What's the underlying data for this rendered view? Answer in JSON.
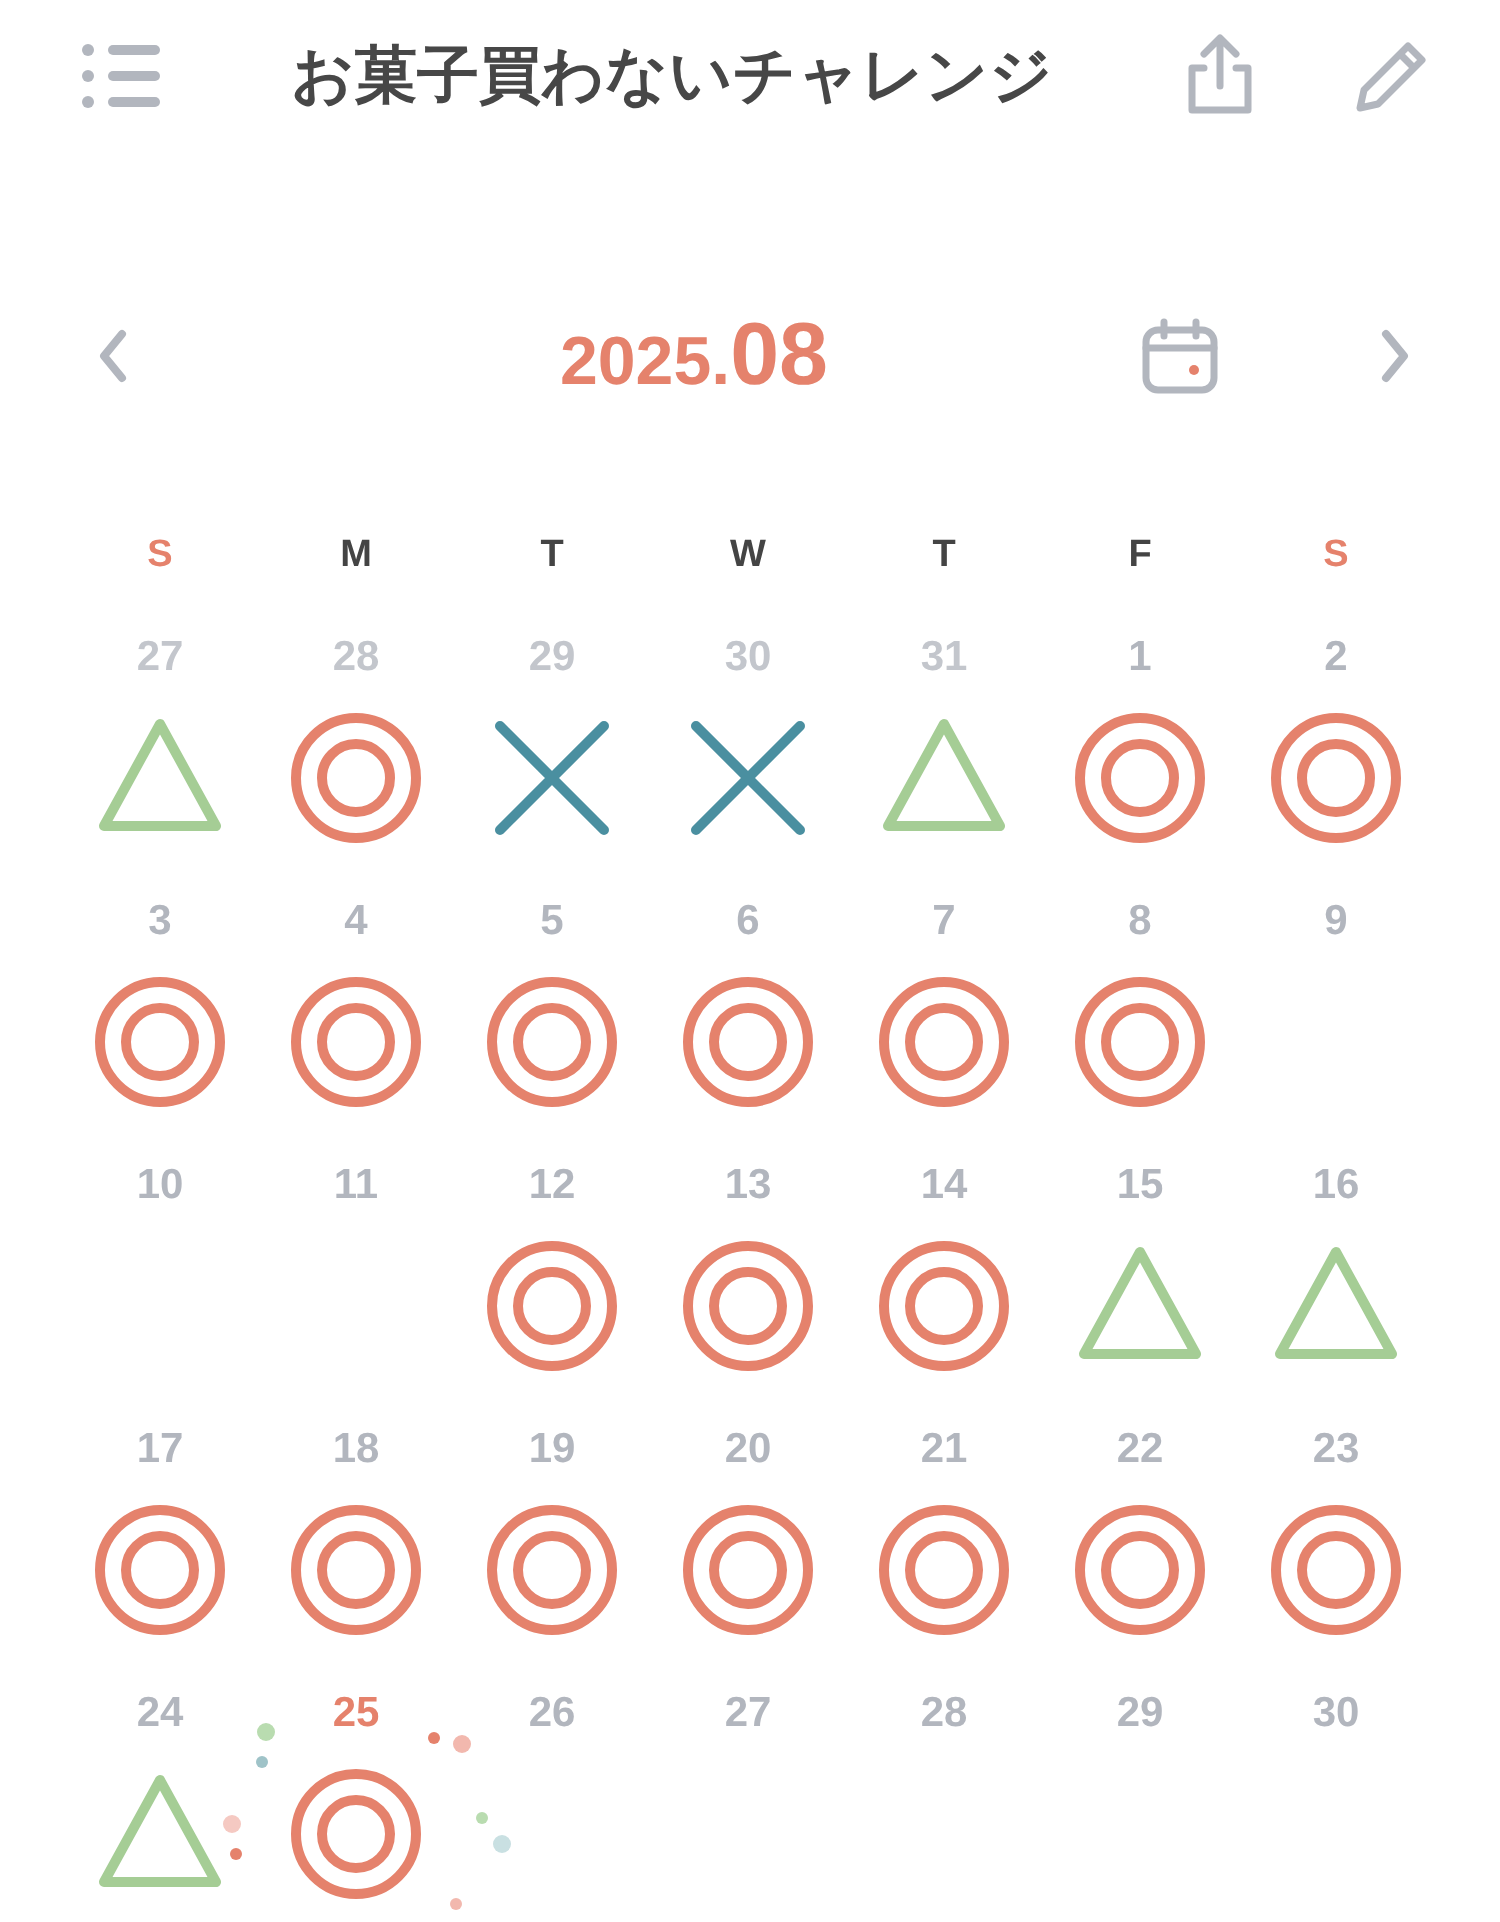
{
  "header": {
    "title": "お菓子買わないチャレンジ"
  },
  "month_nav": {
    "year": "2025.",
    "month": "08"
  },
  "weekdays": [
    {
      "label": "S",
      "weekend": true
    },
    {
      "label": "M",
      "weekend": false
    },
    {
      "label": "T",
      "weekend": false
    },
    {
      "label": "W",
      "weekend": false
    },
    {
      "label": "T",
      "weekend": false
    },
    {
      "label": "F",
      "weekend": false
    },
    {
      "label": "S",
      "weekend": true
    }
  ],
  "weeks": [
    [
      {
        "day": "27",
        "in_month": false,
        "today": false,
        "kind": "triangle"
      },
      {
        "day": "28",
        "in_month": false,
        "today": false,
        "kind": "double_circle"
      },
      {
        "day": "29",
        "in_month": false,
        "today": false,
        "kind": "cross"
      },
      {
        "day": "30",
        "in_month": false,
        "today": false,
        "kind": "cross"
      },
      {
        "day": "31",
        "in_month": false,
        "today": false,
        "kind": "triangle"
      },
      {
        "day": "1",
        "in_month": true,
        "today": false,
        "kind": "double_circle"
      },
      {
        "day": "2",
        "in_month": true,
        "today": false,
        "kind": "double_circle"
      }
    ],
    [
      {
        "day": "3",
        "in_month": true,
        "today": false,
        "kind": "double_circle"
      },
      {
        "day": "4",
        "in_month": true,
        "today": false,
        "kind": "double_circle"
      },
      {
        "day": "5",
        "in_month": true,
        "today": false,
        "kind": "double_circle"
      },
      {
        "day": "6",
        "in_month": true,
        "today": false,
        "kind": "double_circle"
      },
      {
        "day": "7",
        "in_month": true,
        "today": false,
        "kind": "double_circle"
      },
      {
        "day": "8",
        "in_month": true,
        "today": false,
        "kind": "double_circle"
      },
      {
        "day": "9",
        "in_month": true,
        "today": false,
        "kind": "none"
      }
    ],
    [
      {
        "day": "10",
        "in_month": true,
        "today": false,
        "kind": "none"
      },
      {
        "day": "11",
        "in_month": true,
        "today": false,
        "kind": "none"
      },
      {
        "day": "12",
        "in_month": true,
        "today": false,
        "kind": "double_circle"
      },
      {
        "day": "13",
        "in_month": true,
        "today": false,
        "kind": "double_circle"
      },
      {
        "day": "14",
        "in_month": true,
        "today": false,
        "kind": "double_circle"
      },
      {
        "day": "15",
        "in_month": true,
        "today": false,
        "kind": "triangle"
      },
      {
        "day": "16",
        "in_month": true,
        "today": false,
        "kind": "triangle"
      }
    ],
    [
      {
        "day": "17",
        "in_month": true,
        "today": false,
        "kind": "double_circle"
      },
      {
        "day": "18",
        "in_month": true,
        "today": false,
        "kind": "double_circle"
      },
      {
        "day": "19",
        "in_month": true,
        "today": false,
        "kind": "double_circle"
      },
      {
        "day": "20",
        "in_month": true,
        "today": false,
        "kind": "double_circle"
      },
      {
        "day": "21",
        "in_month": true,
        "today": false,
        "kind": "double_circle"
      },
      {
        "day": "22",
        "in_month": true,
        "today": false,
        "kind": "double_circle"
      },
      {
        "day": "23",
        "in_month": true,
        "today": false,
        "kind": "double_circle"
      }
    ],
    [
      {
        "day": "24",
        "in_month": true,
        "today": false,
        "kind": "triangle"
      },
      {
        "day": "25",
        "in_month": true,
        "today": true,
        "kind": "double_circle"
      },
      {
        "day": "26",
        "in_month": true,
        "today": false,
        "kind": "none"
      },
      {
        "day": "27",
        "in_month": true,
        "today": false,
        "kind": "none"
      },
      {
        "day": "28",
        "in_month": true,
        "today": false,
        "kind": "none"
      },
      {
        "day": "29",
        "in_month": true,
        "today": false,
        "kind": "none"
      },
      {
        "day": "30",
        "in_month": true,
        "today": false,
        "kind": "none"
      }
    ]
  ]
}
